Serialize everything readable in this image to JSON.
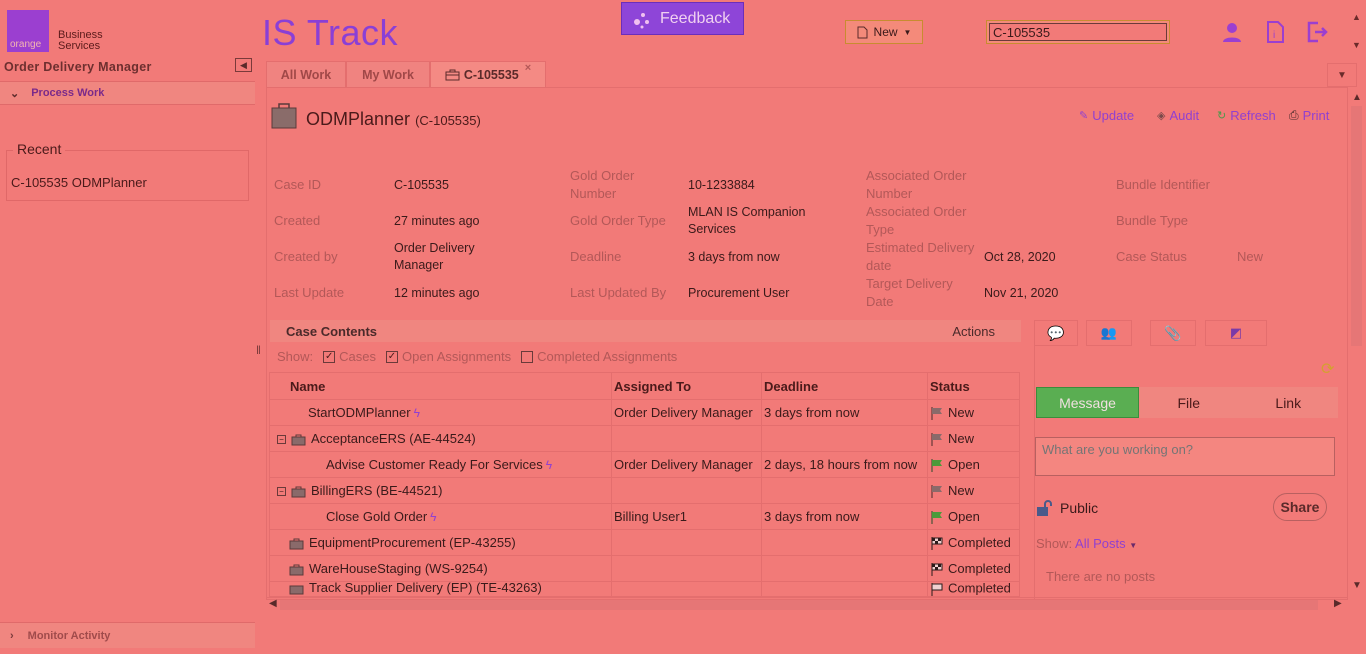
{
  "brand": {
    "logo_word": "orange",
    "line1": "Business",
    "line2": "Services",
    "app_title": "IS Track"
  },
  "header": {
    "feedback_label": "Feedback",
    "new_label": "New",
    "search_value": "C-105535"
  },
  "left": {
    "title": "Order Delivery Manager",
    "process_work": "Process Work",
    "recent_label": "Recent",
    "recent_items": [
      "C-105535 ODMPlanner"
    ],
    "monitor_activity": "Monitor Activity"
  },
  "tabs": {
    "all_work": "All Work",
    "my_work": "My Work",
    "case_tab": "C-105535",
    "close": "×"
  },
  "case": {
    "name": "ODMPlanner",
    "id_paren": "(C-105535)",
    "actions": {
      "update": "Update",
      "audit": "Audit",
      "refresh": "Refresh",
      "print": "Print"
    },
    "fields": {
      "case_id_l": "Case ID",
      "case_id_v": "C-105535",
      "created_l": "Created",
      "created_v": "27 minutes ago",
      "created_by_l": "Created by",
      "created_by_v": "Order Delivery Manager",
      "last_update_l": "Last Update",
      "last_update_v": "12 minutes ago",
      "gold_num_l": "Gold Order Number",
      "gold_num_v": "10-1233884",
      "gold_type_l": "Gold Order Type",
      "gold_type_v": "MLAN IS Companion Services",
      "deadline_l": "Deadline",
      "deadline_v": "3 days from now",
      "last_by_l": "Last Updated By",
      "last_by_v": "Procurement User",
      "assoc_num_l": "Associated Order Number",
      "assoc_type_l": "Associated Order Type",
      "est_l": "Estimated Delivery date",
      "est_v": "Oct 28, 2020",
      "target_l": "Target Delivery Date",
      "target_v": "Nov 21, 2020",
      "bundle_id_l": "Bundle Identifier",
      "bundle_type_l": "Bundle Type",
      "status_l": "Case Status",
      "status_v": "New"
    }
  },
  "contents": {
    "title": "Case Contents",
    "actions": "Actions",
    "show": "Show:",
    "opt_cases": "Cases",
    "opt_open": "Open Assignments",
    "opt_completed": "Completed Assignments",
    "columns": [
      "Name",
      "Assigned To",
      "Deadline",
      "Status"
    ],
    "rows": [
      {
        "name": "StartODMPlanner",
        "assigned": "Order Delivery Manager",
        "deadline": "3 days from now",
        "status": "New"
      },
      {
        "name": "AcceptanceERS (AE-44524)",
        "assigned": "",
        "deadline": "",
        "status": "New"
      },
      {
        "name": "Advise Customer Ready For Services",
        "assigned": "Order Delivery Manager",
        "deadline": "2 days, 18 hours from now",
        "status": "Open"
      },
      {
        "name": "BillingERS (BE-44521)",
        "assigned": "",
        "deadline": "",
        "status": "New"
      },
      {
        "name": "Close Gold Order",
        "assigned": "Billing User1",
        "deadline": "3 days from now",
        "status": "Open"
      },
      {
        "name": "EquipmentProcurement (EP-43255)",
        "assigned": "",
        "deadline": "",
        "status": "Completed"
      },
      {
        "name": "WareHouseStaging (WS-9254)",
        "assigned": "",
        "deadline": "",
        "status": "Completed"
      },
      {
        "name": "Track Supplier Delivery (EP) (TE-43263)",
        "assigned": "",
        "deadline": "",
        "status": "Completed"
      }
    ]
  },
  "social": {
    "tabs": [
      "Message",
      "File",
      "Link"
    ],
    "placeholder": "What are you working on?",
    "public": "Public",
    "share": "Share",
    "show": "Show:",
    "filter": "All Posts",
    "empty": "There are no posts"
  },
  "colors": {
    "accent": "#8e45d8",
    "active_green": "#5aae52"
  }
}
